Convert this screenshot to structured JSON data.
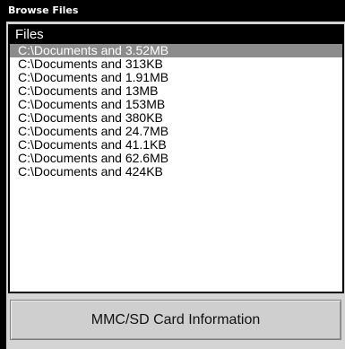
{
  "window": {
    "title": "Browse Files"
  },
  "list": {
    "header": "Files",
    "selected_index": 0,
    "items": [
      "C:\\Documents and 3.52MB",
      "C:\\Documents and 313KB",
      "C:\\Documents and 1.91MB",
      "C:\\Documents and 13MB",
      "C:\\Documents and 153MB",
      "C:\\Documents and 380KB",
      "C:\\Documents and 24.7MB",
      "C:\\Documents and 41.1KB",
      "C:\\Documents and 62.6MB",
      "C:\\Documents and 424KB"
    ]
  },
  "button": {
    "label": "MMC/SD Card Information"
  },
  "colors": {
    "title_bar": "#000000",
    "panel": "#d4d4d4",
    "selection": "#8c8c8c"
  }
}
